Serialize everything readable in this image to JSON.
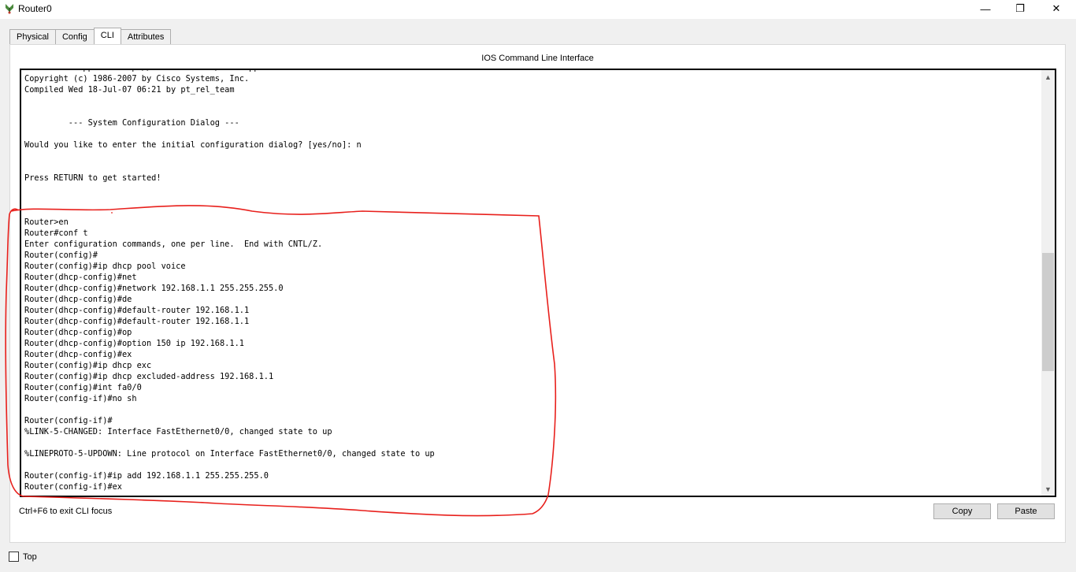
{
  "window": {
    "title": "Router0",
    "minimize_glyph": "—",
    "maximize_glyph": "❐",
    "close_glyph": "✕"
  },
  "tabs": [
    {
      "label": "Physical"
    },
    {
      "label": "Config"
    },
    {
      "label": "CLI"
    },
    {
      "label": "Attributes"
    }
  ],
  "active_tab": "CLI",
  "panel": {
    "title": "IOS Command Line Interface",
    "hint": "Ctrl+F6 to exit CLI focus",
    "copy_label": "Copy",
    "paste_label": "Paste"
  },
  "console": {
    "lines": [
      "Technical Support: http://www.cisco.com/techsupport",
      "Copyright (c) 1986-2007 by Cisco Systems, Inc.",
      "Compiled Wed 18-Jul-07 06:21 by pt_rel_team",
      "",
      "",
      "         --- System Configuration Dialog ---",
      "",
      "Would you like to enter the initial configuration dialog? [yes/no]: n",
      "",
      "",
      "Press RETURN to get started!",
      "",
      "",
      "",
      "Router>en",
      "Router#conf t",
      "Enter configuration commands, one per line.  End with CNTL/Z.",
      "Router(config)#",
      "Router(config)#ip dhcp pool voice",
      "Router(dhcp-config)#net",
      "Router(dhcp-config)#network 192.168.1.1 255.255.255.0",
      "Router(dhcp-config)#de",
      "Router(dhcp-config)#default-router 192.168.1.1",
      "Router(dhcp-config)#default-router 192.168.1.1",
      "Router(dhcp-config)#op",
      "Router(dhcp-config)#option 150 ip 192.168.1.1",
      "Router(dhcp-config)#ex",
      "Router(config)#ip dhcp exc",
      "Router(config)#ip dhcp excluded-address 192.168.1.1",
      "Router(config)#int fa0/0",
      "Router(config-if)#no sh",
      "",
      "Router(config-if)#",
      "%LINK-5-CHANGED: Interface FastEthernet0/0, changed state to up",
      "",
      "%LINEPROTO-5-UPDOWN: Line protocol on Interface FastEthernet0/0, changed state to up",
      "",
      "Router(config-if)#ip add 192.168.1.1 255.255.255.0",
      "Router(config-if)#ex"
    ]
  },
  "scrollbar": {
    "up_glyph": "▲",
    "down_glyph": "▼"
  },
  "top_checkbox": {
    "label": "Top",
    "checked": false
  },
  "colors": {
    "annotation": "#e8201c",
    "window_bg": "#f0f0f0"
  }
}
